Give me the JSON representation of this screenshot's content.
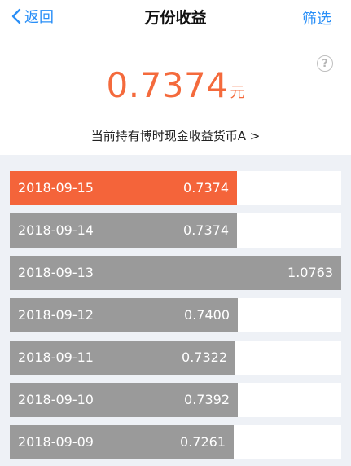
{
  "nav": {
    "back_label": "返回",
    "title": "万份收益",
    "filter_label": "筛选"
  },
  "summary": {
    "value": "0.7374",
    "unit": "元",
    "fund_name": "当前持有博时现金收益货币A >"
  },
  "icons": {
    "back": "chevron-left-icon",
    "help": "question-circle-icon"
  },
  "colors": {
    "accent": "#2a8ff7",
    "highlight": "#f4643a",
    "bar": "#9a9a9a",
    "list_background": "#eef1f6"
  },
  "records": [
    {
      "date": "2018-09-15",
      "value": "0.7374",
      "amount": 0.7374,
      "active": true
    },
    {
      "date": "2018-09-14",
      "value": "0.7374",
      "amount": 0.7374,
      "active": false
    },
    {
      "date": "2018-09-13",
      "value": "1.0763",
      "amount": 1.0763,
      "active": false
    },
    {
      "date": "2018-09-12",
      "value": "0.7400",
      "amount": 0.74,
      "active": false
    },
    {
      "date": "2018-09-11",
      "value": "0.7322",
      "amount": 0.7322,
      "active": false
    },
    {
      "date": "2018-09-10",
      "value": "0.7392",
      "amount": 0.7392,
      "active": false
    },
    {
      "date": "2018-09-09",
      "value": "0.7261",
      "amount": 0.7261,
      "active": false
    }
  ]
}
